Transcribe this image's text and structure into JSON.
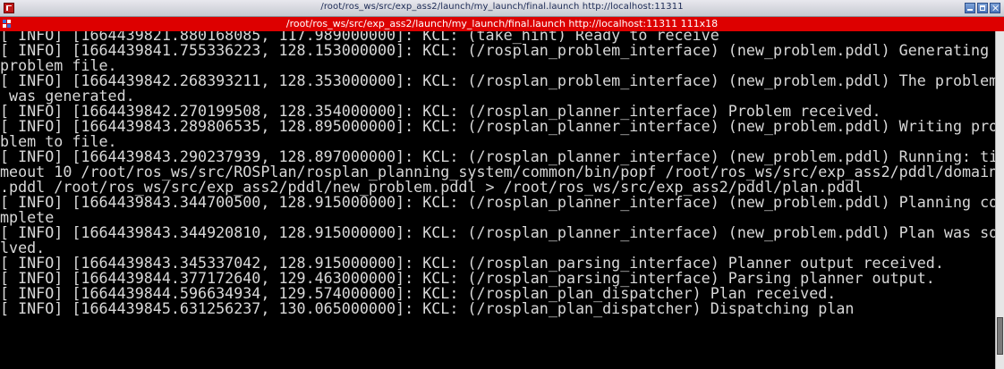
{
  "window": {
    "title": "/root/ros_ws/src/exp_ass2/launch/my_launch/final.launch http://localhost:11311",
    "icon": "terminal-app-icon",
    "buttons": [
      "minimize-icon",
      "maximize-icon",
      "close-icon"
    ],
    "title_bar_color": "#c6c9d1"
  },
  "tab": {
    "title": "/root/ros_ws/src/exp_ass2/launch/my_launch/final.launch http://localhost:11311 111x18",
    "color": "#dd0000"
  },
  "terminal": {
    "background": "#000000",
    "foreground": "#d8d8d8",
    "lines": [
      "[ INFO] [1664439821.880168085, 117.989000000]: KCL: (take_hint) Ready to receive",
      "[ INFO] [1664439841.755336223, 128.153000000]: KCL: (/rosplan_problem_interface) (new_problem.pddl) Generating",
      "problem file.",
      "[ INFO] [1664439842.268393211, 128.353000000]: KCL: (/rosplan_problem_interface) (new_problem.pddl) The problem",
      " was generated.",
      "[ INFO] [1664439842.270199508, 128.354000000]: KCL: (/rosplan_planner_interface) Problem received.",
      "[ INFO] [1664439843.289806535, 128.895000000]: KCL: (/rosplan_planner_interface) (new_problem.pddl) Writing pro",
      "blem to file.",
      "[ INFO] [1664439843.290237939, 128.897000000]: KCL: (/rosplan_planner_interface) (new_problem.pddl) Running: ti",
      "meout 10 /root/ros_ws/src/ROSPlan/rosplan_planning_system/common/bin/popf /root/ros_ws/src/exp_ass2/pddl/domain",
      ".pddl /root/ros_ws/src/exp_ass2/pddl/new_problem.pddl > /root/ros_ws/src/exp_ass2/pddl/plan.pddl",
      "[ INFO] [1664439843.344700500, 128.915000000]: KCL: (/rosplan_planner_interface) (new_problem.pddl) Planning co",
      "mplete",
      "[ INFO] [1664439843.344920810, 128.915000000]: KCL: (/rosplan_planner_interface) (new_problem.pddl) Plan was so",
      "lved.",
      "[ INFO] [1664439843.345337042, 128.915000000]: KCL: (/rosplan_parsing_interface) Planner output received.",
      "[ INFO] [1664439844.377172640, 129.463000000]: KCL: (/rosplan_parsing_interface) Parsing planner output.",
      "[ INFO] [1664439844.596634934, 129.574000000]: KCL: (/rosplan_plan_dispatcher) Plan received.",
      "[ INFO] [1664439845.631256237, 130.065000000]: KCL: (/rosplan_plan_dispatcher) Dispatching plan"
    ]
  },
  "scrollbar": {
    "position": 0.96
  }
}
